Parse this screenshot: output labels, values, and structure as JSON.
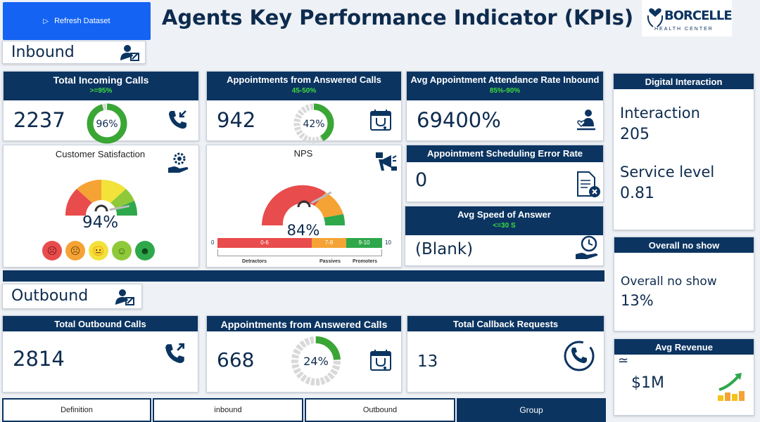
{
  "header": {
    "refresh_label": "Refresh Dataset",
    "title": "Agents Key Performance Indicator (KPIs)",
    "logo_text": "BORCELLE",
    "logo_sub": "HEALTH CENTER"
  },
  "inbound": {
    "section_label": "Inbound",
    "total_incoming": {
      "title": "Total Incoming Calls",
      "target": ">=95%",
      "value": "2237",
      "ring_label": "96%",
      "ring_pct": 0.96
    },
    "appointments": {
      "title": "Appointments from Answered Calls",
      "target": "45-50%",
      "value": "942",
      "ring_label": "42%",
      "ring_pct": 0.42
    },
    "attendance": {
      "title": "Avg Appointment Attendance Rate Inbound",
      "target": "85%-90%",
      "value": "69400%"
    },
    "csat": {
      "title": "Customer Satisfaction",
      "value": "94%",
      "gauge_pct": 0.94
    },
    "nps": {
      "title": "NPS",
      "value": "84%",
      "gauge_pct": 0.84,
      "scale_min": "0",
      "scale_max": "10",
      "bands": [
        {
          "range": "0-6",
          "label": "Detractors",
          "color": "#e84c4c"
        },
        {
          "range": "7-8",
          "label": "Passives",
          "color": "#f5a334"
        },
        {
          "range": "9-10",
          "label": "Promoters",
          "color": "#2ea84a"
        }
      ]
    },
    "scheduling_error": {
      "title": "Appointment Scheduling Error Rate",
      "value": "0"
    },
    "speed_answer": {
      "title": "Avg Speed of Answer",
      "target": "<=30 S",
      "value": "(Blank)"
    }
  },
  "digital": {
    "title": "Digital Interaction",
    "interaction_label": "Interaction",
    "interaction_value": "205",
    "service_label": "Service level",
    "service_value": "0.81"
  },
  "noshow": {
    "title": "Overall no show",
    "label": "Overall no show",
    "value": "13%"
  },
  "revenue": {
    "title": "Avg Revenue",
    "approx": "≃",
    "value": "$1M"
  },
  "outbound": {
    "section_label": "Outbound",
    "total_outbound": {
      "title": "Total Outbound Calls",
      "value": "2814"
    },
    "appointments": {
      "title": "Appointments from Answered Calls",
      "value": "668",
      "ring_label": "24%",
      "ring_pct": 0.24
    },
    "callback": {
      "title": "Total Callback Requests",
      "value": "13"
    }
  },
  "tabs": [
    {
      "label": "Definition"
    },
    {
      "label": "inbound"
    },
    {
      "label": "Outbound"
    },
    {
      "label": "Group",
      "active": true
    }
  ],
  "colors": {
    "navy": "#0b3461",
    "accent": "#1463f3",
    "green": "#2ea84a",
    "target_green": "#3ddc3d"
  }
}
